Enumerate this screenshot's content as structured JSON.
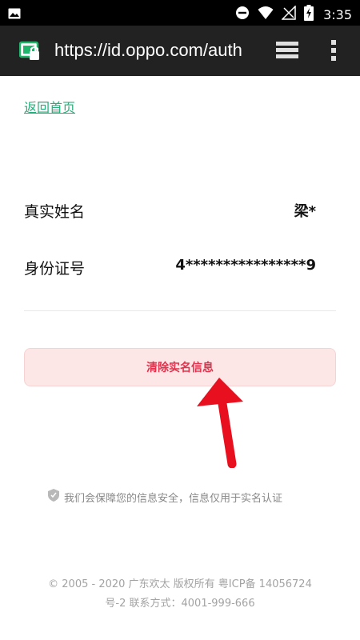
{
  "status_bar": {
    "time": "3:35",
    "icons": [
      "image-icon",
      "do-not-disturb-icon",
      "wifi-icon",
      "signal-icon",
      "battery-charging-icon"
    ]
  },
  "browser": {
    "url": "https://id.oppo.com/auth",
    "icons": [
      "lock-icon",
      "tabs-icon",
      "more-menu-icon"
    ]
  },
  "page": {
    "back_link": "返回首页",
    "fields": [
      {
        "label": "真实姓名",
        "value": "梁*"
      },
      {
        "label": "身份证号",
        "value": "4****************9"
      }
    ],
    "clear_button": "清除实名信息",
    "notice": "我们会保障您的信息安全，信息仅用于实名认证",
    "footer_line1": "© 2005 - 2020 广东欢太 版权所有 粤ICP备 14056724",
    "footer_line2": "号-2 联系方式：4001-999-666"
  },
  "colors": {
    "link": "#23b07a",
    "button_bg": "#fde6e6",
    "button_text": "#e0334d",
    "arrow": "#e8101e"
  }
}
